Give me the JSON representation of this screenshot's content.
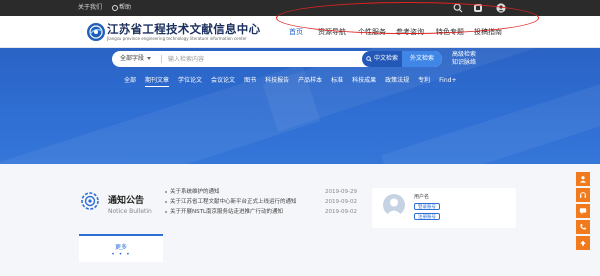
{
  "topbar": {
    "about": "关于我们",
    "help": "帮助"
  },
  "header": {
    "site_title": "江苏省工程技术文献信息中心",
    "site_subtitle": "Jiangsu province engineering technology literature information center"
  },
  "nav": {
    "items": [
      {
        "label": "首页",
        "active": true
      },
      {
        "label": "资源导航",
        "active": false
      },
      {
        "label": "个性服务",
        "active": false
      },
      {
        "label": "参考咨询",
        "active": false
      },
      {
        "label": "特色专题",
        "active": false
      },
      {
        "label": "投稿指南",
        "active": false
      }
    ]
  },
  "search": {
    "categories": [
      "全部",
      "期刊文章",
      "学位论文",
      "会议论文",
      "图书",
      "科技报告",
      "产品样本",
      "标准",
      "科技成果",
      "政策法规",
      "专利",
      "Find+"
    ],
    "active_category": "期刊文章",
    "scope_label": "全部字段",
    "placeholder": "输入检索内容",
    "btn_cn": "中文检索",
    "btn_en": "外文检索",
    "advanced": "高级检索",
    "knowledge": "知识脉络"
  },
  "notice": {
    "title": "通知公告",
    "title_en": "Notice Bulletin",
    "more": "更多",
    "more_dots": "• • •",
    "items": [
      {
        "title": "关于系统维护的通知",
        "date": "2019-09-29"
      },
      {
        "title": "关于江苏省工程文献中心新平台正式上线运行的通知",
        "date": "2019-09-02"
      },
      {
        "title": "关于开展NSTL南京服务站走进推广行动的通知",
        "date": "2019-09-02"
      }
    ]
  },
  "user": {
    "name": "用户名",
    "btn1": "登录账号",
    "btn2": "注册账号"
  },
  "colors": {
    "accent": "#2e6fd6",
    "hero": "#2f6ed3",
    "float": "#f07a1c",
    "highlight": "#e02222"
  }
}
